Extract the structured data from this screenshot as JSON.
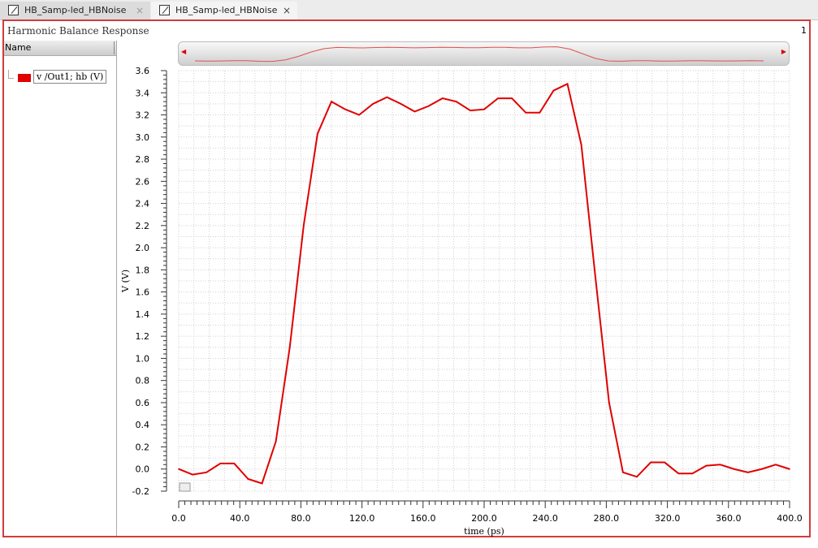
{
  "tabs": [
    {
      "label": "HB_Samp-led_HBNoise",
      "close": "×"
    },
    {
      "label": "HB_Samp-led_HBNoise",
      "close": "×"
    }
  ],
  "panel": {
    "title": "Harmonic Balance Response",
    "page_number": "1"
  },
  "sidebar": {
    "column_header": "Name",
    "legend_label": "v /Out1; hb (V)",
    "legend_color": "#e00000"
  },
  "chart_data": {
    "type": "line",
    "title": "",
    "xlabel": "time (ps)",
    "ylabel": "V (V)",
    "xlim": [
      0,
      400
    ],
    "ylim": [
      -0.2,
      3.6
    ],
    "grid": true,
    "xticks": [
      "0.0",
      "40.0",
      "80.0",
      "120.0",
      "160.0",
      "200.0",
      "240.0",
      "280.0",
      "320.0",
      "360.0",
      "400.0"
    ],
    "yticks": [
      "-0.2",
      "0.0",
      "0.2",
      "0.4",
      "0.6",
      "0.8",
      "1.0",
      "1.2",
      "1.4",
      "1.6",
      "1.8",
      "2.0",
      "2.2",
      "2.4",
      "2.6",
      "2.8",
      "3.0",
      "3.2",
      "3.4",
      "3.6"
    ],
    "series": [
      {
        "name": "v /Out1; hb (V)",
        "color": "#e00000",
        "x_step": 9.0909,
        "y": [
          0.0,
          -0.05,
          -0.03,
          0.05,
          0.05,
          -0.09,
          -0.13,
          0.25,
          1.1,
          2.2,
          3.03,
          3.32,
          3.25,
          3.2,
          3.3,
          3.36,
          3.3,
          3.23,
          3.28,
          3.35,
          3.32,
          3.24,
          3.25,
          3.35,
          3.35,
          3.22,
          3.22,
          3.42,
          3.48,
          2.93,
          1.75,
          0.6,
          -0.03,
          -0.07,
          0.06,
          0.06,
          -0.04,
          -0.04,
          0.03,
          0.04,
          0.0,
          -0.03,
          0.0,
          0.04,
          0.0
        ]
      }
    ]
  }
}
